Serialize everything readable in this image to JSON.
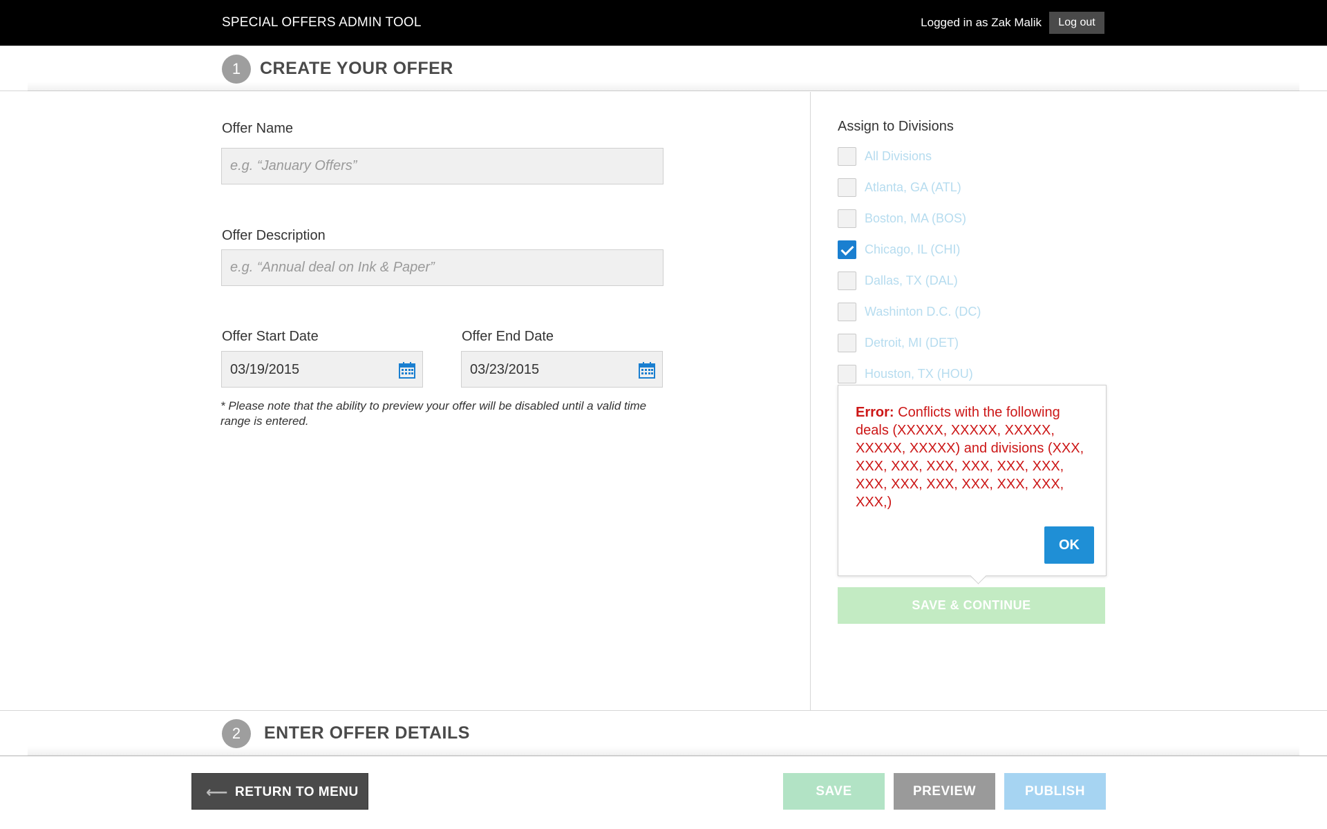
{
  "header": {
    "app_title": "SPECIAL OFFERS ADMIN TOOL",
    "user_label": "Logged in as Zak Malik",
    "logout_label": "Log out"
  },
  "step1": {
    "number": "1",
    "title": "CREATE YOUR OFFER"
  },
  "step2": {
    "number": "2",
    "title": "ENTER OFFER DETAILS"
  },
  "form": {
    "offer_name_label": "Offer Name",
    "offer_name_placeholder": "e.g. “January Offers”",
    "offer_name_value": "",
    "offer_description_label": "Offer Description",
    "offer_description_placeholder": "e.g. “Annual deal on Ink & Paper”",
    "offer_description_value": "",
    "start_date_label": "Offer Start Date",
    "start_date_value": "03/19/2015",
    "end_date_label": "Offer End Date",
    "end_date_value": "03/23/2015",
    "note": "* Please note that the ability to preview your offer will be disabled until a valid time range is entered."
  },
  "divisions": {
    "heading": "Assign to Divisions",
    "items": [
      {
        "label": "All Divisions",
        "checked": false
      },
      {
        "label": "Atlanta, GA (ATL)",
        "checked": false
      },
      {
        "label": "Boston, MA (BOS)",
        "checked": false
      },
      {
        "label": "Chicago, IL (CHI)",
        "checked": true
      },
      {
        "label": "Dallas, TX (DAL)",
        "checked": false
      },
      {
        "label": "Washinton D.C. (DC)",
        "checked": false
      },
      {
        "label": "Detroit, MI (DET)",
        "checked": false
      },
      {
        "label": "Houston, TX (HOU)",
        "checked": false
      }
    ]
  },
  "error": {
    "prefix": "Error:",
    "message": " Conflicts with the following deals (XXXXX, XXXXX, XXXXX, XXXXX, XXXXX) and divisions (XXX, XXX, XXX, XXX, XXX, XXX, XXX, XXX, XXX, XXX, XXX, XXX, XXX, XXX,)",
    "ok_label": "OK"
  },
  "save_continue_label": "SAVE & CONTINUE",
  "footer": {
    "return_label": "RETURN TO MENU",
    "save_label": "SAVE",
    "preview_label": "PREVIEW",
    "publish_label": "PUBLISH"
  },
  "colors": {
    "accent_blue": "#1f8fd6",
    "error_red": "#cc1616",
    "disabled_green": "#c3ebc3"
  }
}
